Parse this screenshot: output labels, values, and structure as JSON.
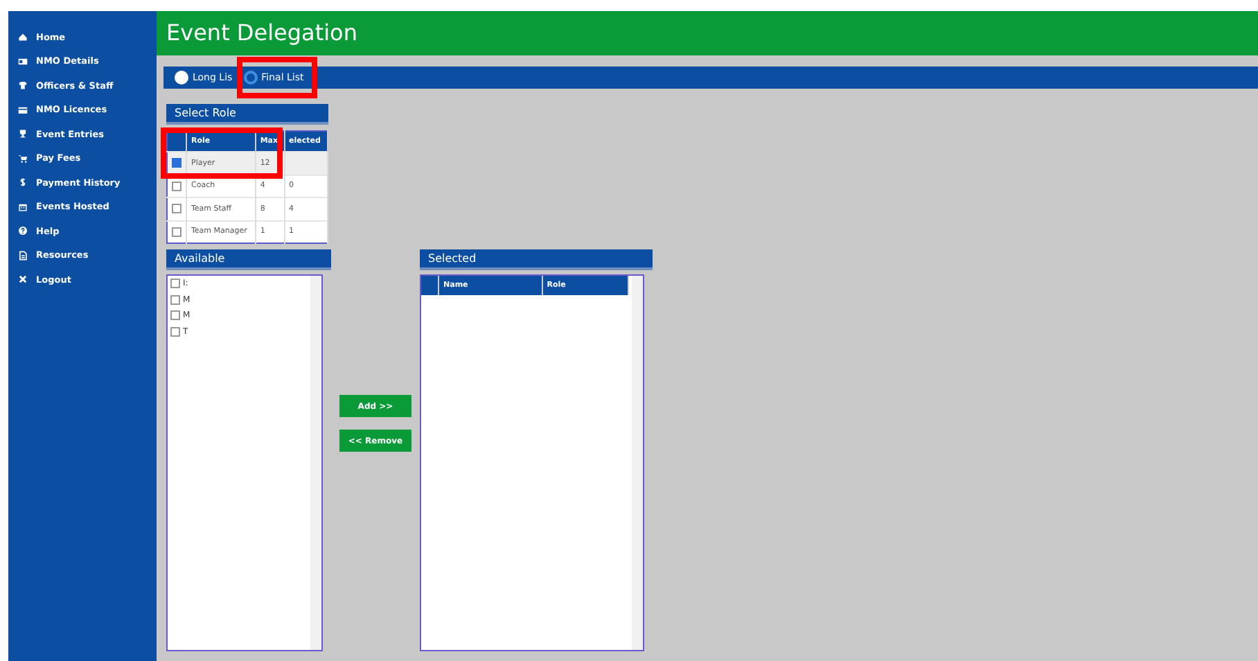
{
  "sidebar": {
    "items": [
      {
        "label": "Home"
      },
      {
        "label": "NMO Details"
      },
      {
        "label": "Officers & Staff"
      },
      {
        "label": "NMO Licences"
      },
      {
        "label": "Event Entries"
      },
      {
        "label": "Pay Fees"
      },
      {
        "label": "Payment History"
      },
      {
        "label": "Events Hosted"
      },
      {
        "label": "Help"
      },
      {
        "label": "Resources"
      },
      {
        "label": "Logout"
      }
    ]
  },
  "page_title": "Event Delegation",
  "list_options": [
    {
      "label": "Long Lis",
      "selected": false
    },
    {
      "label": "Final List",
      "selected": true
    }
  ],
  "select_role": {
    "title": "Select Role",
    "columns": [
      "Role",
      "Max",
      "elected"
    ],
    "rows": [
      {
        "checked": true,
        "cells": [
          "Player",
          "12",
          ""
        ]
      },
      {
        "checked": false,
        "cells": [
          "Coach",
          "4",
          "0"
        ]
      },
      {
        "checked": false,
        "cells": [
          "Team Staff",
          "8",
          "4"
        ]
      },
      {
        "checked": false,
        "cells": [
          "Team Manager",
          "1",
          "1"
        ]
      }
    ]
  },
  "available": {
    "title": "Available",
    "items": [
      {
        "label": "I:",
        "checked": false
      },
      {
        "label": "M",
        "checked": false
      },
      {
        "label": "M",
        "checked": false
      },
      {
        "label": "T",
        "checked": false
      }
    ]
  },
  "buttons": [
    "Add >>",
    "<< Remove"
  ],
  "selected": {
    "title": "Selected",
    "columns": [
      "Name",
      "Role"
    ]
  }
}
